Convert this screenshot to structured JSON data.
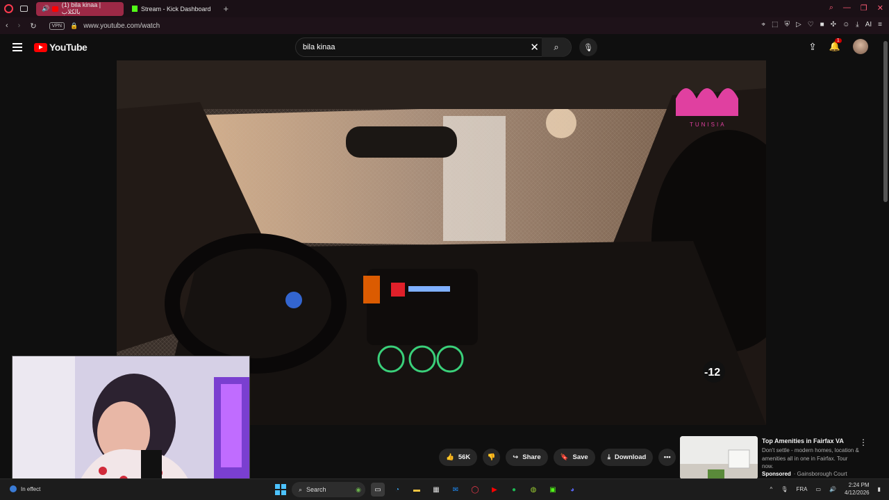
{
  "browser": {
    "tabs": [
      {
        "label": "(1) bila kinaa | بالكلاب",
        "active": true
      },
      {
        "label": "Stream - Kick Dashboard",
        "active": false
      }
    ],
    "vpn_label": "VPN",
    "url": "www.youtube.com/watch"
  },
  "youtube": {
    "logo_text": "YouTube",
    "search_value": "bila kinaa",
    "notification_count": "1"
  },
  "video": {
    "channel_watermark": "TUNISIA",
    "age_rating": "-12"
  },
  "actions": {
    "likes": "56K",
    "share": "Share",
    "save": "Save",
    "download": "Download"
  },
  "ad": {
    "title": "Top Amenities in Fairfax VA",
    "description": "Don't settle - modern homes, location & amenities all in one in Fairfax. Tour now.",
    "sponsored": "Sponsored",
    "advertiser": "Gainsborough Court"
  },
  "taskbar": {
    "weather": "In effect",
    "search_label": "Search",
    "language": "FRA",
    "time": "2:24 PM",
    "date": "4/12/2026"
  },
  "colors": {
    "youtube_red": "#ff0000",
    "opera_accent": "#ff3b4f",
    "kick_green": "#53fc18"
  }
}
